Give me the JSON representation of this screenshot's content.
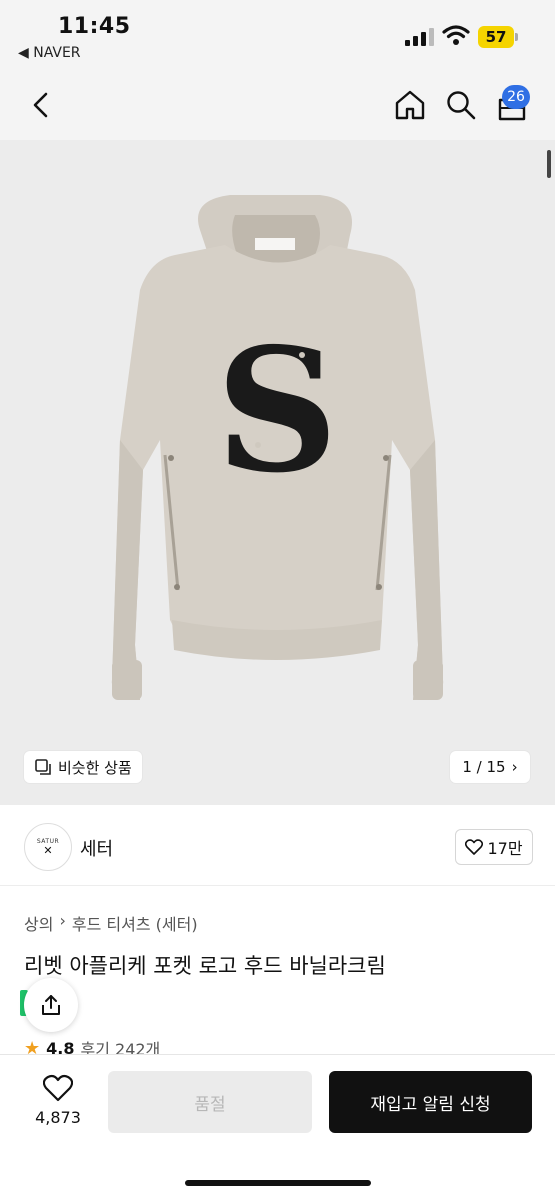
{
  "status_bar": {
    "time": "11:45",
    "back_app": "◀ NAVER",
    "battery": "57",
    "icons": [
      "signal-icon",
      "wifi-icon",
      "battery-icon"
    ]
  },
  "nav": {
    "icons": [
      "back-arrow-icon",
      "home-icon",
      "search-icon",
      "cart-icon"
    ],
    "cart_badge": "26"
  },
  "gallery": {
    "similar_label": "비슷한 상품",
    "counter": "1 / 15",
    "background": "#ececec"
  },
  "brand": {
    "logo_text": "SATUR",
    "name": "세터",
    "likes": "17만"
  },
  "product": {
    "breadcrumb": [
      "상의",
      "후드 티셔츠 (세터)"
    ],
    "title": "리벳 아플리케 포켓 로고 후드 바닐라크림",
    "rating": "4.8",
    "reviews": "후기 242개"
  },
  "bottom_bar": {
    "wish_count": "4,873",
    "soldout_label": "품절",
    "restock_label": "재입고 알림 신청"
  },
  "colors": {
    "accent": "#2f6fe4",
    "battery": "#f5d400",
    "primary_button": "#111111",
    "disabled_button": "#ebebeb",
    "star": "#f0a020"
  }
}
